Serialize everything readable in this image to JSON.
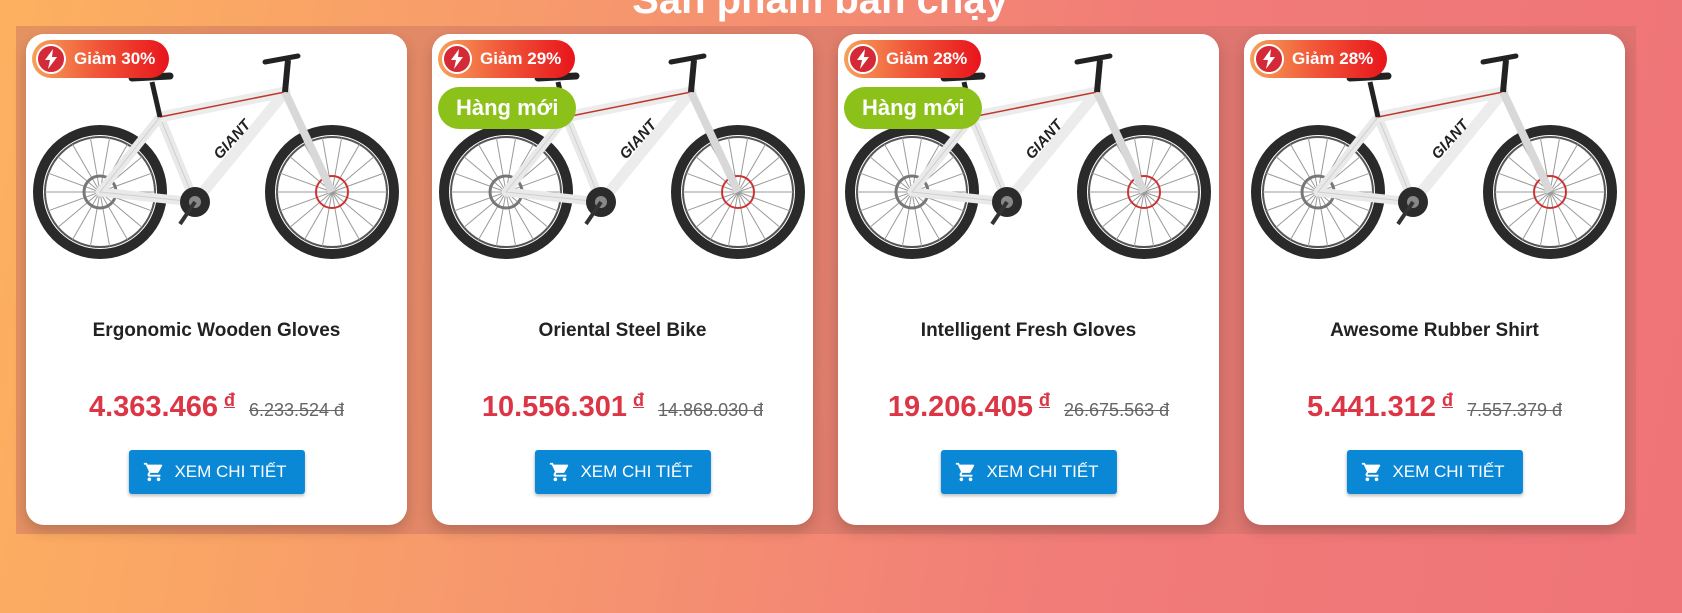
{
  "section": {
    "title": "Sản phẩm bán chạy"
  },
  "products": [
    {
      "sale": "Giảm 30%",
      "is_new": false,
      "new_label": "",
      "name": "Ergonomic Wooden Gloves",
      "price": "4.363.466",
      "currency": "đ",
      "old_price": "6.233.524 đ",
      "button": "XEM CHI TIẾT"
    },
    {
      "sale": "Giảm 29%",
      "is_new": true,
      "new_label": "Hàng mới",
      "name": "Oriental Steel Bike",
      "price": "10.556.301",
      "currency": "đ",
      "old_price": "14.868.030 đ",
      "button": "XEM CHI TIẾT"
    },
    {
      "sale": "Giảm 28%",
      "is_new": true,
      "new_label": "Hàng mới",
      "name": "Intelligent Fresh Gloves",
      "price": "19.206.405",
      "currency": "đ",
      "old_price": "26.675.563 đ",
      "button": "XEM CHI TIẾT"
    },
    {
      "sale": "Giảm 28%",
      "is_new": false,
      "new_label": "",
      "name": "Awesome Rubber Shirt",
      "price": "5.441.312",
      "currency": "đ",
      "old_price": "7.557.379 đ",
      "button": "XEM CHI TIẾT"
    }
  ],
  "icons": {
    "sale": "lightning-bolt-icon",
    "button": "shopping-cart-icon",
    "image": "mountain-bike-image"
  },
  "colors": {
    "price": "#dc3545",
    "button": "#0a88d6",
    "new_badge": "#8cc11a",
    "sale_badge": "#e8141c"
  }
}
